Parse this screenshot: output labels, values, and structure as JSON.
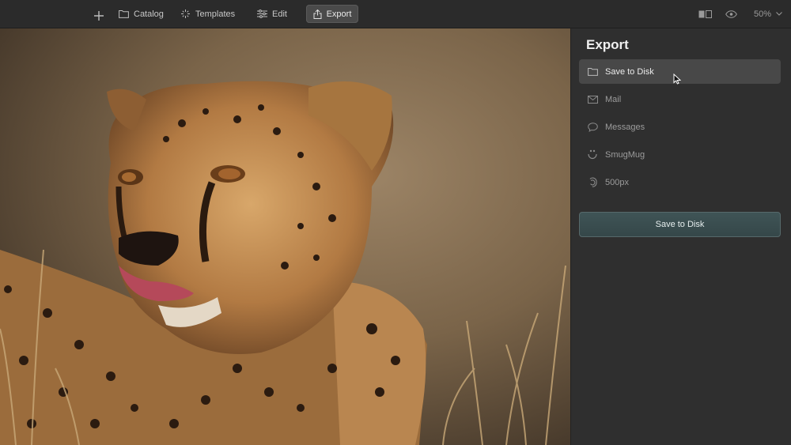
{
  "toolbar": {
    "catalog_label": "Catalog",
    "templates_label": "Templates",
    "edit_label": "Edit",
    "export_label": "Export",
    "zoom": "50%"
  },
  "panel": {
    "title": "Export",
    "options": [
      {
        "label": "Save to Disk",
        "icon": "folder-icon",
        "selected": true
      },
      {
        "label": "Mail",
        "icon": "mail-icon"
      },
      {
        "label": "Messages",
        "icon": "messages-icon"
      },
      {
        "label": "SmugMug",
        "icon": "smugmug-icon"
      },
      {
        "label": "500px",
        "icon": "500px-icon"
      }
    ],
    "action_label": "Save to Disk"
  },
  "colors": {
    "background": "#2a2a2a",
    "panel": "#2f2f2f",
    "selected_row": "#484848",
    "action_button": "#3f5456"
  }
}
